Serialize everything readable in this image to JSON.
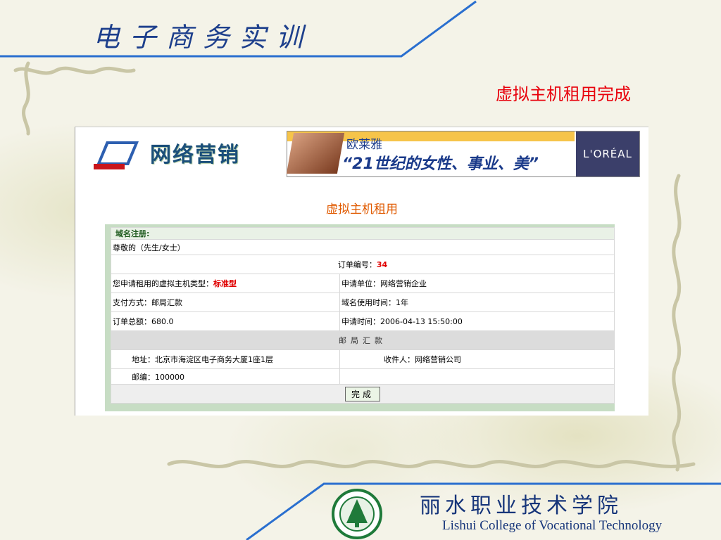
{
  "slide": {
    "top_title": "电子商务实训",
    "title": "虚拟主机租用完成"
  },
  "site": {
    "logo_text": "网络营销",
    "ad": {
      "brand_cn": "欧莱雅",
      "slogan": "“21世纪的女性、事业、美”",
      "logo": "L'ORÉAL"
    },
    "page_heading": "虚拟主机租用"
  },
  "order": {
    "section_label": "域名注册:",
    "greeting": "尊敬的（先生/女士）",
    "order_no_label": "订单编号：",
    "order_no": "34",
    "host_type_label": "您申请租用的虚拟主机类型：",
    "host_type": "标准型",
    "applicant_label": "申请单位：",
    "applicant": "网络营销企业",
    "payment_label": "支付方式：",
    "payment": "邮局汇款",
    "domain_period_label": "域名使用时间：",
    "domain_period": "1年",
    "total_label": "订单总额：",
    "total": "680.0",
    "apply_time_label": "申请时间：",
    "apply_time": "2006-04-13 15:50:00",
    "remit_heading": "邮局汇款",
    "address_label": "地址：",
    "address": "北京市海淀区电子商务大厦1座1层",
    "recipient_label": "收件人：",
    "recipient": "网络营销公司",
    "postcode_label": "邮编：",
    "postcode": "100000",
    "complete_button": "完成"
  },
  "footer": {
    "school_cn": "丽水职业技术学院",
    "school_en": "Lishui College of Vocational Technology"
  },
  "colors": {
    "accent_blue": "#1d3f8c",
    "title_red": "#e8000b",
    "panel_green": "#c7ddc4"
  }
}
